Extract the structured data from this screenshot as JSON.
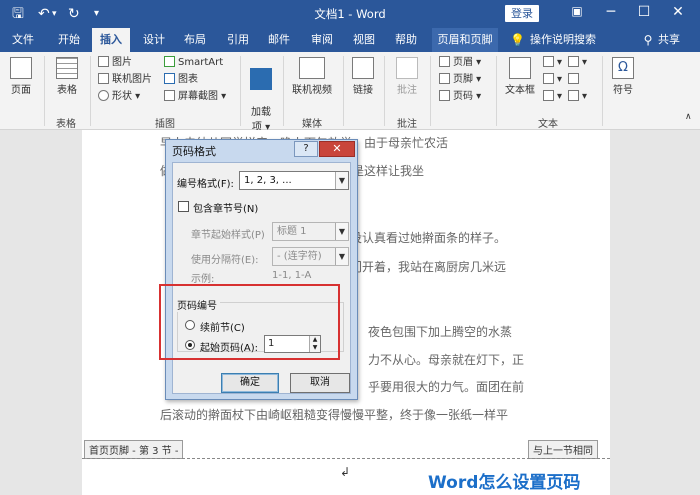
{
  "window": {
    "title": "文档1 - Word",
    "login_label": "登录"
  },
  "quick_access": {
    "save_icon": "save-icon",
    "undo_icon": "undo-icon",
    "redo_icon": "redo-icon",
    "customize_icon": "customize-icon"
  },
  "tabs": [
    "文件",
    "开始",
    "插入",
    "设计",
    "布局",
    "引用",
    "邮件",
    "审阅",
    "视图",
    "帮助",
    "页眉和页脚",
    "操作说明搜索",
    "共享"
  ],
  "ribbon": {
    "pages_label": "页面",
    "table_label": "表格",
    "table_group": "表格",
    "picture": "图片",
    "online_picture": "联机图片",
    "shapes": "形状 ▾",
    "smartart": "SmartArt",
    "chart": "图表",
    "screenshot": "屏幕截图 ▾",
    "illustrations_group": "插图",
    "addins_label": "加载\n项 ▾",
    "online_video": "联机视频",
    "media_group": "媒体",
    "link_label": "链接",
    "comment_label": "批注",
    "comment_group": "批注",
    "header": "页眉 ▾",
    "footer": "页脚 ▾",
    "page_number": "页码 ▾",
    "textbox_label": "文本框",
    "text_group": "文本",
    "symbol_label": "符号"
  },
  "document": {
    "lines": [
      "早上去幼儿园学拼音，晚上下午放学，由于母亲忙农活",
      "做饭，母亲便让我带着我去。母亲也是这样让我坐",
      "没认真看过她擀面条的样子。",
      "门开着，我站在离厨房几米远",
      "夜色包围下加上腾空的水蒸",
      "力不从心。母亲就在灯下，正",
      "乎要用很大的力气。面团在前",
      "后滚动的擀面杖下由崎岖粗糙变得慢慢平整，终于像一张纸一样平"
    ],
    "footer_left": "首页页脚 - 第 3 节 -",
    "footer_right": "与上一节相同",
    "watermark": "Word怎么设置页码"
  },
  "dialog": {
    "title": "页码格式",
    "help_label": "?",
    "close_label": "✕",
    "number_format_label": "编号格式(F):",
    "number_format_value": "1, 2, 3, ...",
    "include_chapter_label": "包含章节号(N)",
    "chapter_style_label": "章节起始样式(P)",
    "chapter_style_value": "标题 1",
    "separator_label": "使用分隔符(E):",
    "separator_value": "-  (连字符)",
    "example_label": "示例:",
    "example_value": "1-1, 1-A",
    "numbering_group": "页码编号",
    "continue_label": "续前节(C)",
    "start_at_label": "起始页码(A):",
    "start_at_value": "1",
    "ok_label": "确定",
    "cancel_label": "取消"
  }
}
